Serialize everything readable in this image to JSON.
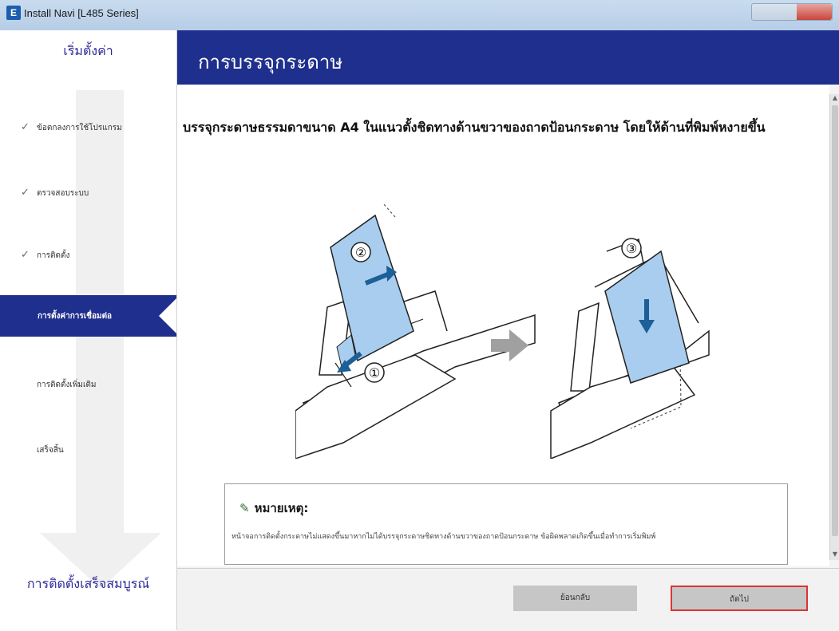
{
  "window": {
    "title": "Install Navi [L485 Series]",
    "app_icon": "E"
  },
  "sidebar": {
    "top_label": "เริ่มตั้งค่า",
    "items": [
      {
        "label": "ข้อตกลงการใช้โปรแกรม",
        "checked": true,
        "active": false
      },
      {
        "label": "ตรวจสอบระบบ",
        "checked": true,
        "active": false
      },
      {
        "label": "การติดตั้ง",
        "checked": true,
        "active": false
      },
      {
        "label": "การตั้งค่าการเชื่อมต่อ",
        "checked": false,
        "active": true
      },
      {
        "label": "การติดตั้งเพิ่มเติม",
        "checked": false,
        "active": false
      },
      {
        "label": "เสร็จสิ้น",
        "checked": false,
        "active": false
      }
    ],
    "bottom_label": "การติดตั้งเสร็จสมบูรณ์"
  },
  "header": {
    "title": "การบรรจุกระดาษ"
  },
  "main": {
    "instruction": "บรรจุกระดาษธรรมดาขนาด A4 ในแนวตั้งชิดทางด้านขวาของถาดป้อนกระดาษ โดยให้ด้านที่พิมพ์หงายขึ้น",
    "step_markers": [
      "②",
      "①",
      "③"
    ],
    "note_title": "หมายเหตุ:",
    "note_body": "หน้าจอการติดตั้งกระดาษไม่แสดงขึ้นมาหากไม่ได้บรรจุกระดาษชิดทางด้านขวาของถาดป้อนกระดาษ ข้อผิดพลาดเกิดขึ้นเมื่อทำการเริ่มพิมพ์"
  },
  "footer": {
    "back_label": "ย้อนกลับ",
    "next_label": "ถัดไป"
  },
  "colors": {
    "brand": "#1f2f8d",
    "paper": "#a8cdee",
    "arrow": "#1d5f97",
    "next_highlight": "#dd3333"
  }
}
